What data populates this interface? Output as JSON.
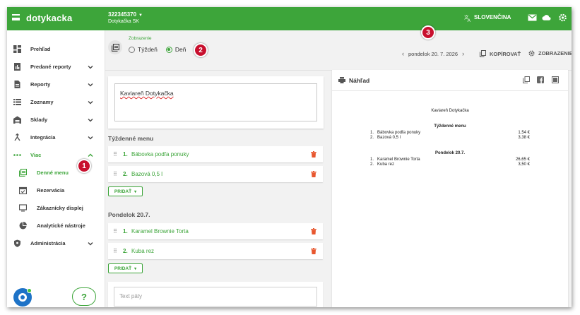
{
  "topbar": {
    "logo": "dotykacka",
    "account_id": "322345370",
    "account_name": "Dotykačka SK",
    "language": "SLOVENČINA",
    "icons": [
      "menu-icon",
      "translate-icon",
      "mail-icon",
      "cloud-icon",
      "settings-icon"
    ]
  },
  "sidebar": {
    "items": [
      {
        "label": "Prehľad",
        "icon": "dashboard-icon"
      },
      {
        "label": "Predané reporty",
        "icon": "report-icon"
      },
      {
        "label": "Reporty",
        "icon": "document-icon"
      },
      {
        "label": "Zoznamy",
        "icon": "list-icon"
      },
      {
        "label": "Sklady",
        "icon": "warehouse-icon"
      },
      {
        "label": "Integrácia",
        "icon": "integration-icon"
      },
      {
        "label": "Viac",
        "icon": "more-icon"
      }
    ],
    "sub_items": [
      {
        "label": "Denné menu",
        "icon": "daily-menu-icon"
      },
      {
        "label": "Rezervácia",
        "icon": "calendar-icon"
      },
      {
        "label": "Zákaznícky displej",
        "icon": "monitor-icon"
      },
      {
        "label": "Analytické nástroje",
        "icon": "pie-chart-icon"
      }
    ],
    "admin": {
      "label": "Administrácia",
      "icon": "shield-icon"
    },
    "help_label": "?"
  },
  "toolbar": {
    "display_label": "Zobrazenie",
    "week_label": "Týždeň",
    "day_label": "Deň",
    "selected": "Deň",
    "date": "pondelok 20. 7. 2026",
    "copy_label": "KOPÍROVAŤ",
    "display_btn_label": "ZOBRAZENIE"
  },
  "badges": [
    "1",
    "2",
    "3"
  ],
  "editor": {
    "business_name": "Kaviareň Dotykačka",
    "weekly_heading": "Týždenné menu",
    "weekly_items": [
      {
        "num": "1.",
        "name": "Bábovka podľa ponuky"
      },
      {
        "num": "2.",
        "name": "Bazová 0,5 l"
      }
    ],
    "day_heading": "Pondelok 20.7.",
    "day_items": [
      {
        "num": "1.",
        "name": "Karamel Brownie Torta"
      },
      {
        "num": "2.",
        "name": "Kuba rez"
      }
    ],
    "add_label": "PRIDAŤ",
    "footer_placeholder": "Text päty"
  },
  "preview": {
    "title": "Náhľad",
    "business_name": "Kaviareň Dotykačka",
    "weekly_heading": "Týždenné menu",
    "weekly_lines": [
      {
        "num": "1.",
        "name": "Bábovka podľa ponuky",
        "price": "1,54 €"
      },
      {
        "num": "2.",
        "name": "Bazová 0,5 l",
        "price": "3,38 €"
      }
    ],
    "day_heading": "Pondelok 20.7.",
    "day_lines": [
      {
        "num": "1.",
        "name": "Karamel Brownie Torta",
        "price": "26,65 €"
      },
      {
        "num": "2.",
        "name": "Kuba rez",
        "price": "3,50 €"
      }
    ]
  },
  "colors": {
    "accent": "#3da53a",
    "badge": "#c8102e",
    "chat": "#1e73c7"
  }
}
